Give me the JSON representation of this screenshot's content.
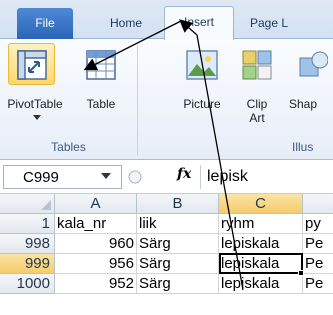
{
  "ribbon_tabs": {
    "file": "File",
    "home": "Home",
    "insert": "Insert",
    "page_layout": "Page L"
  },
  "ribbon": {
    "pivot_table": "PivotTable",
    "table": "Table",
    "picture": "Picture",
    "clip_art_1": "Clip",
    "clip_art_2": "Art",
    "shapes": "Shap",
    "group_tables": "Tables",
    "group_illustrations": "Illus"
  },
  "formula_bar": {
    "name_box": "C999",
    "fx_label": "fx",
    "content": "lepisk"
  },
  "grid": {
    "columns": [
      "A",
      "B",
      "C"
    ],
    "rows": [
      {
        "num": "1",
        "a": "kala_nr",
        "b": "liik",
        "c": "ryhm",
        "d": "py"
      },
      {
        "num": "998",
        "a": "960",
        "b": "Särg",
        "c": "lepiskala",
        "d": "Pe"
      },
      {
        "num": "999",
        "a": "956",
        "b": "Särg",
        "c": "lepiskala",
        "d": "Pe"
      },
      {
        "num": "1000",
        "a": "952",
        "b": "Särg",
        "c": "lepiskala",
        "d": "Pe"
      }
    ]
  },
  "colors": {
    "accent_orange": "#f6cc6c",
    "file_tab": "#2a64b8",
    "arrow": "#000000"
  }
}
